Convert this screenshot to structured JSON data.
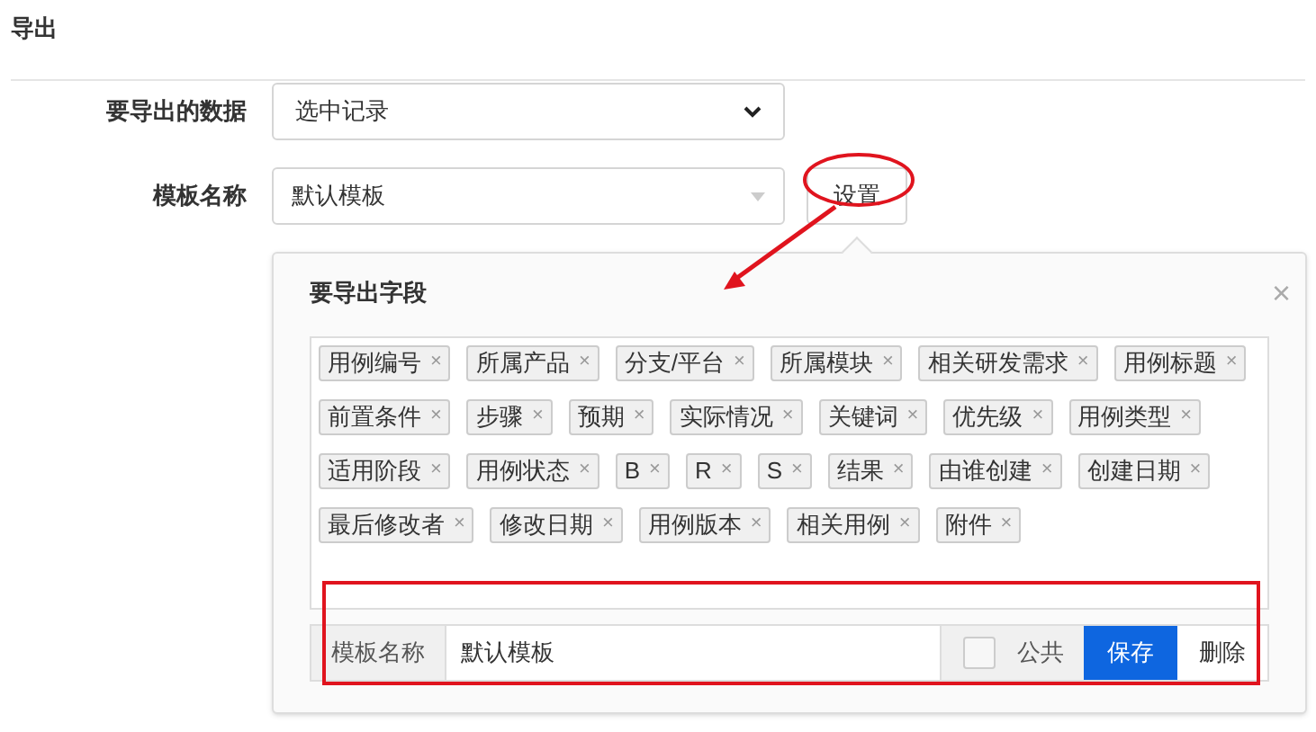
{
  "header": {
    "title": "导出"
  },
  "form": [
    {
      "label": "要导出的数据",
      "kind": "select",
      "value": "选中记录"
    },
    {
      "label": "模板名称",
      "kind": "combo",
      "value": "默认模板",
      "button": "设置"
    }
  ],
  "popover": {
    "title": "要导出字段",
    "close": "×",
    "remove_glyph": "×",
    "fields": [
      "用例编号",
      "所属产品",
      "分支/平台",
      "所属模块",
      "相关研发需求",
      "用例标题",
      "前置条件",
      "步骤",
      "预期",
      "实际情况",
      "关键词",
      "优先级",
      "用例类型",
      "适用阶段",
      "用例状态",
      "B",
      "R",
      "S",
      "结果",
      "由谁创建",
      "创建日期",
      "最后修改者",
      "修改日期",
      "用例版本",
      "相关用例",
      "附件"
    ],
    "footer": {
      "label": "模板名称",
      "value": "默认模板",
      "public": {
        "label": "公共",
        "checked": false
      },
      "save": "保存",
      "delete": "删除"
    }
  }
}
